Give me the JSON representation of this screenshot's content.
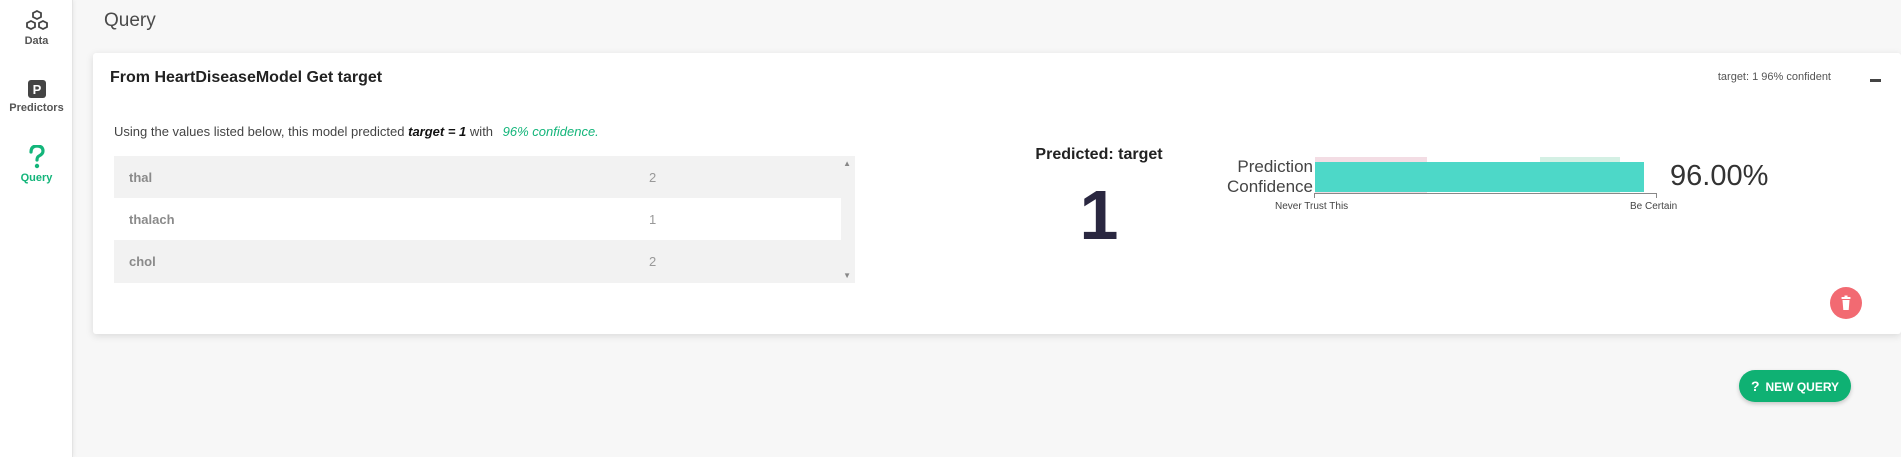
{
  "sidebar": {
    "items": [
      {
        "label": "Data",
        "icon": "cubes-icon"
      },
      {
        "label": "Predictors",
        "icon": "parking-p-icon"
      },
      {
        "label": "Query",
        "icon": "question-icon"
      }
    ],
    "active": "Query"
  },
  "page": {
    "title": "Query"
  },
  "card": {
    "title": "From HeartDiseaseModel Get target",
    "summary": "target: 1 96% confident",
    "explain": {
      "lead": "Using the values listed below, this model predicted",
      "prediction": "target = 1",
      "mid": "with",
      "confidence": "96% confidence."
    },
    "rows": [
      {
        "key": "thal",
        "value": "2"
      },
      {
        "key": "thalach",
        "value": "1"
      },
      {
        "key": "chol",
        "value": "2"
      }
    ],
    "predicted_label": "Predicted: target",
    "predicted_value": "1",
    "gauge": {
      "label_line1": "Prediction",
      "label_line2": "Confidence",
      "percent": "96.00%",
      "value": 0.96,
      "left_label": "Never Trust This",
      "right_label": "Be Certain"
    }
  },
  "buttons": {
    "new_query": "NEW QUERY"
  },
  "colors": {
    "accent": "#13b57a",
    "gauge": "#4dd8c8",
    "delete": "#f26a72",
    "button": "#0fb173"
  }
}
